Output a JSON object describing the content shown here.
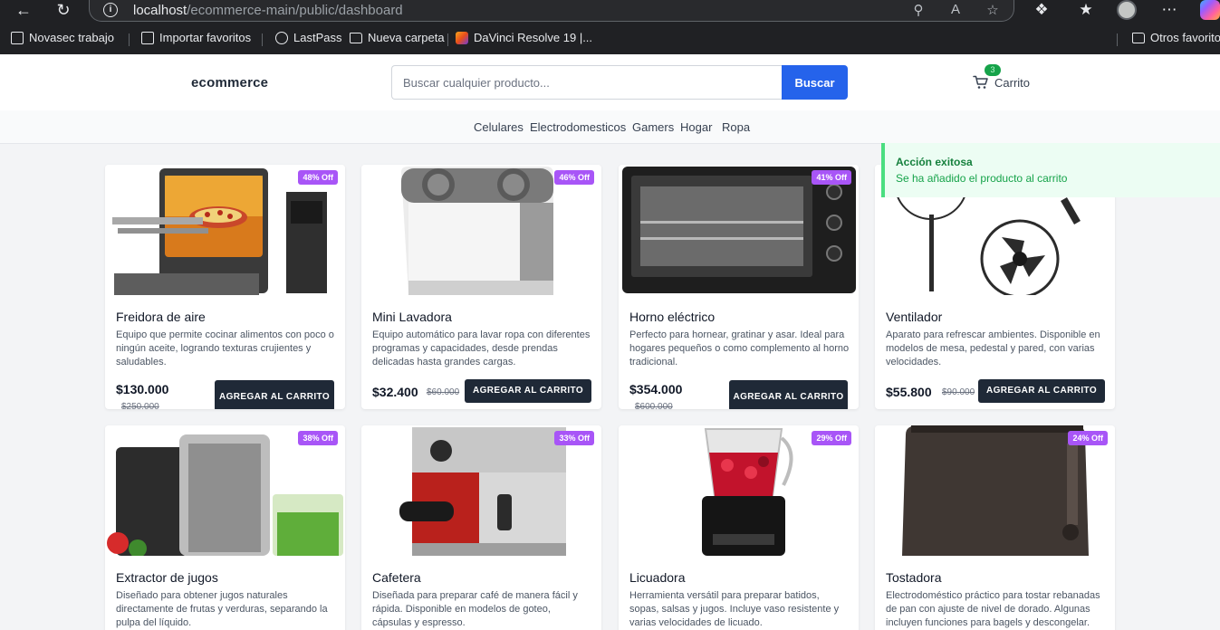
{
  "browser": {
    "url_host": "localhost",
    "url_path": "/ecommerce-main/public/dashboard",
    "bookmarks": [
      "Novasec trabajo",
      "Importar favoritos",
      "LastPass",
      "Nueva carpeta",
      "DaVinci Resolve 19 |...",
      "Otros favoritos"
    ]
  },
  "header": {
    "brand": "ecommerce",
    "search_placeholder": "Buscar cualquier producto...",
    "search_button": "Buscar",
    "cart_label": "Carrito",
    "cart_count": "3"
  },
  "categories": [
    "Celulares",
    "Electrodomesticos",
    "Gamers",
    "Hogar",
    "Ropa"
  ],
  "toast": {
    "title": "Acción exitosa",
    "message": "Se ha añadido el producto al carrito"
  },
  "colors": {
    "primary": "#2563eb",
    "dark_button": "#1f2937",
    "discount_badge": "#a855f7",
    "success": "#16a34a"
  },
  "products": [
    {
      "name": "Freidora de aire",
      "discount": "48% Off",
      "description": "Equipo que permite cocinar alimentos con poco o ningún aceite, logrando texturas crujientes y saludables.",
      "price": "$130.000",
      "old_price": "$250.000",
      "button": "AGREGAR AL CARRITO"
    },
    {
      "name": "Mini Lavadora",
      "discount": "46% Off",
      "description": "Equipo automático para lavar ropa con diferentes programas y capacidades, desde prendas delicadas hasta grandes cargas.",
      "price": "$32.400",
      "old_price": "$60.000",
      "button": "AGREGAR AL CARRITO"
    },
    {
      "name": "Horno eléctrico",
      "discount": "41% Off",
      "description": "Perfecto para hornear, gratinar y asar. Ideal para hogares pequeños o como complemento al horno tradicional.",
      "price": "$354.000",
      "old_price": "$600.000",
      "button": "AGREGAR AL CARRITO"
    },
    {
      "name": "Ventilador",
      "discount": "",
      "description": "Aparato para refrescar ambientes. Disponible en modelos de mesa, pedestal y pared, con varias velocidades.",
      "price": "$55.800",
      "old_price": "$90.000",
      "button": "AGREGAR AL CARRITO"
    },
    {
      "name": "Extractor de jugos",
      "discount": "38% Off",
      "description": "Diseñado para obtener jugos naturales directamente de frutas y verduras, separando la pulpa del líquido."
    },
    {
      "name": "Cafetera",
      "discount": "33% Off",
      "description": "Diseñada para preparar café de manera fácil y rápida. Disponible en modelos de goteo, cápsulas y espresso."
    },
    {
      "name": "Licuadora",
      "discount": "29% Off",
      "description": "Herramienta versátil para preparar batidos, sopas, salsas y jugos. Incluye vaso resistente y varias velocidades de licuado."
    },
    {
      "name": "Tostadora",
      "discount": "24% Off",
      "description": "Electrodoméstico práctico para tostar rebanadas de pan con ajuste de nivel de dorado. Algunas incluyen funciones para bagels y descongelar."
    }
  ]
}
